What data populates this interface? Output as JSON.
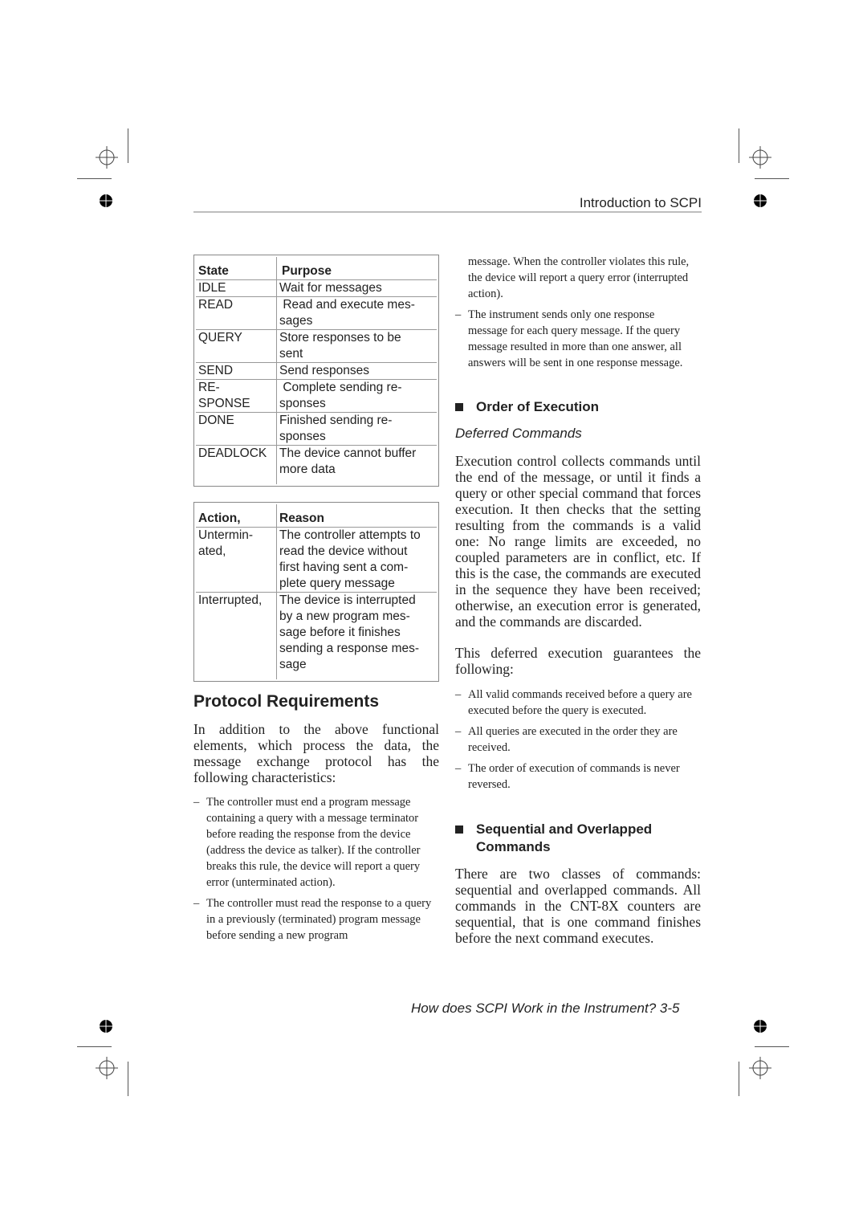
{
  "header": {
    "title": "Introduction to SCPI"
  },
  "state_table": {
    "headers": [
      "State",
      "Purpose"
    ],
    "rows": [
      [
        "IDLE",
        "Wait for messages"
      ],
      [
        "READ",
        " Read and execute mes-\nsages"
      ],
      [
        "QUERY",
        "Store responses to be\nsent"
      ],
      [
        "SEND",
        "Send responses"
      ],
      [
        "RE-\nSPONSE",
        " Complete sending re-\nsponses"
      ],
      [
        "DONE",
        "Finished sending re-\nsponses"
      ],
      [
        "DEADLOCK",
        "The device cannot buffer\nmore data"
      ]
    ]
  },
  "action_table": {
    "headers": [
      "Action,",
      "Reason"
    ],
    "rows": [
      [
        "Untermin-\nated,",
        "The controller attempts to\nread the device without\nfirst having sent a com-\nplete query message"
      ],
      [
        "Interrupted,",
        "The device is interrupted\nby a new program mes-\nsage before it finishes\nsending a response mes-\nsage"
      ]
    ]
  },
  "protocol": {
    "heading": "Protocol Requirements",
    "intro": "In addition to the above functional elements, which process the data, the message exchange protocol has the following characteristics:",
    "bullets": [
      "The controller must end a program message containing a query with a message terminator before reading the response from the device (address the device as talker). If the controller breaks this rule, the device will report a query error (unterminated action).",
      "The controller must read the response to a query in a previously (terminated) program message before sending a new program"
    ],
    "continued": "message. When the controller violates this rule, the device will report a query error (interrupted action).",
    "bullets2": [
      "The instrument sends only one response message for each query message. If the query message resulted in more than one answer, all answers will be sent in one response message."
    ]
  },
  "order_of_execution": {
    "heading": "Order of Execution",
    "subheading": "Deferred Commands",
    "para1": "Execution control collects commands until the end of the message, or until it finds a query or other special command that forces execution. It then checks that the setting resulting from the commands is a valid one: No range limits are exceeded, no coupled parameters are in conflict, etc. If this is the case, the commands are executed in the sequence they have been received; otherwise, an execution error is generated, and the commands are discarded.",
    "para2": "This deferred execution guarantees the following:",
    "bullets": [
      "All valid commands received before a query are executed before the query is executed.",
      "All queries are executed in the order they are received.",
      "The order of execution of commands is never reversed."
    ]
  },
  "sequential": {
    "heading": "Sequential and Overlapped Commands",
    "para": "There are two classes of commands: sequential and overlapped commands. All commands in the CNT-8X counters are sequential, that is one command finishes before the next command executes."
  },
  "footer": {
    "text": "How does SCPI Work in the Instrument? 3-5"
  },
  "icons": {
    "bullet": "square-bullet",
    "dash": "–"
  }
}
